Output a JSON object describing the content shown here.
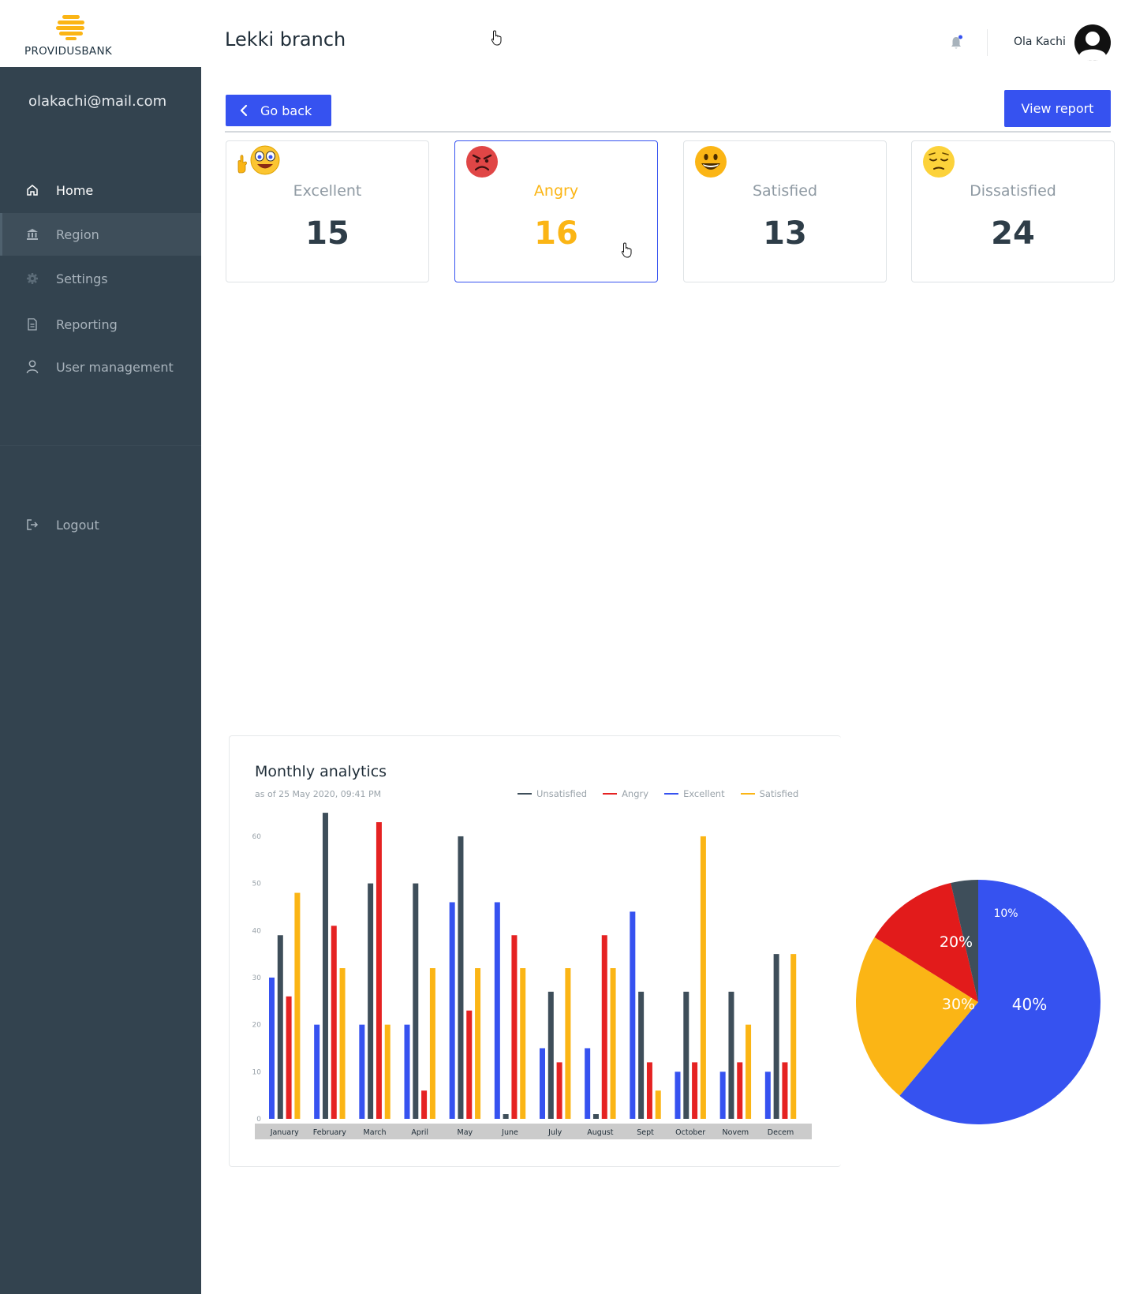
{
  "brand": {
    "name": "PROVIDUSBANK"
  },
  "sidebar": {
    "email": "olakachi@mail.com",
    "items": [
      {
        "label": "Home",
        "icon": "home-icon"
      },
      {
        "label": "Region",
        "icon": "bank-icon"
      },
      {
        "label": "Settings",
        "icon": "gear-icon"
      },
      {
        "label": "Reporting",
        "icon": "document-icon"
      },
      {
        "label": "User management",
        "icon": "user-icon"
      }
    ],
    "logout": "Logout"
  },
  "header": {
    "title": "Lekki branch",
    "user_name": "Ola Kachi"
  },
  "actions": {
    "back": "Go back",
    "report": "View report"
  },
  "cards": [
    {
      "label": "Excellent",
      "value": "15"
    },
    {
      "label": "Angry",
      "value": "16"
    },
    {
      "label": "Satisfied",
      "value": "13"
    },
    {
      "label": "Dissatisfied",
      "value": "24"
    }
  ],
  "colors": {
    "accent": "#3652f0",
    "unsatisfied": "#3e4e5a",
    "angry": "#e52222",
    "excellent": "#3652f0",
    "satisfied": "#fbb515"
  },
  "chart": {
    "title": "Monthly analytics",
    "subtitle": "as of 25 May 2020, 09:41 PM",
    "legend": [
      "Unsatisfied",
      "Angry",
      "Excellent",
      "Satisfied"
    ]
  },
  "chart_data": [
    {
      "type": "bar",
      "title": "Monthly analytics",
      "categories": [
        "January",
        "February",
        "March",
        "April",
        "May",
        "June",
        "July",
        "August",
        "Sept",
        "October",
        "Novem",
        "Decem"
      ],
      "yticks": [
        0,
        10,
        20,
        30,
        40,
        50,
        60
      ],
      "ylim": [
        0,
        62
      ],
      "series": [
        {
          "name": "Excellent",
          "color": "#3652f0",
          "values": [
            30,
            20,
            20,
            20,
            46,
            46,
            15,
            15,
            44,
            10,
            10,
            10
          ]
        },
        {
          "name": "Unsatisfied",
          "color": "#3e4e5a",
          "values": [
            39,
            65,
            50,
            50,
            60,
            1,
            27,
            1,
            27,
            27,
            27,
            35
          ]
        },
        {
          "name": "Angry",
          "color": "#e52222",
          "values": [
            26,
            41,
            63,
            6,
            23,
            39,
            12,
            39,
            12,
            12,
            12,
            12
          ]
        },
        {
          "name": "Satisfied",
          "color": "#fbb515",
          "values": [
            48,
            32,
            20,
            32,
            32,
            32,
            32,
            32,
            6,
            60,
            20,
            35
          ]
        }
      ],
      "legend_position": "top-right",
      "grid": false
    },
    {
      "type": "pie",
      "slices": [
        {
          "label": "40%",
          "value": 40,
          "color": "#3652f0"
        },
        {
          "label": "30%",
          "value": 30,
          "color": "#fbb515"
        },
        {
          "label": "20%",
          "value": 20,
          "color": "#e21b1b"
        },
        {
          "label": "10%",
          "value": 10,
          "color": "#3e4e5a"
        }
      ]
    }
  ]
}
